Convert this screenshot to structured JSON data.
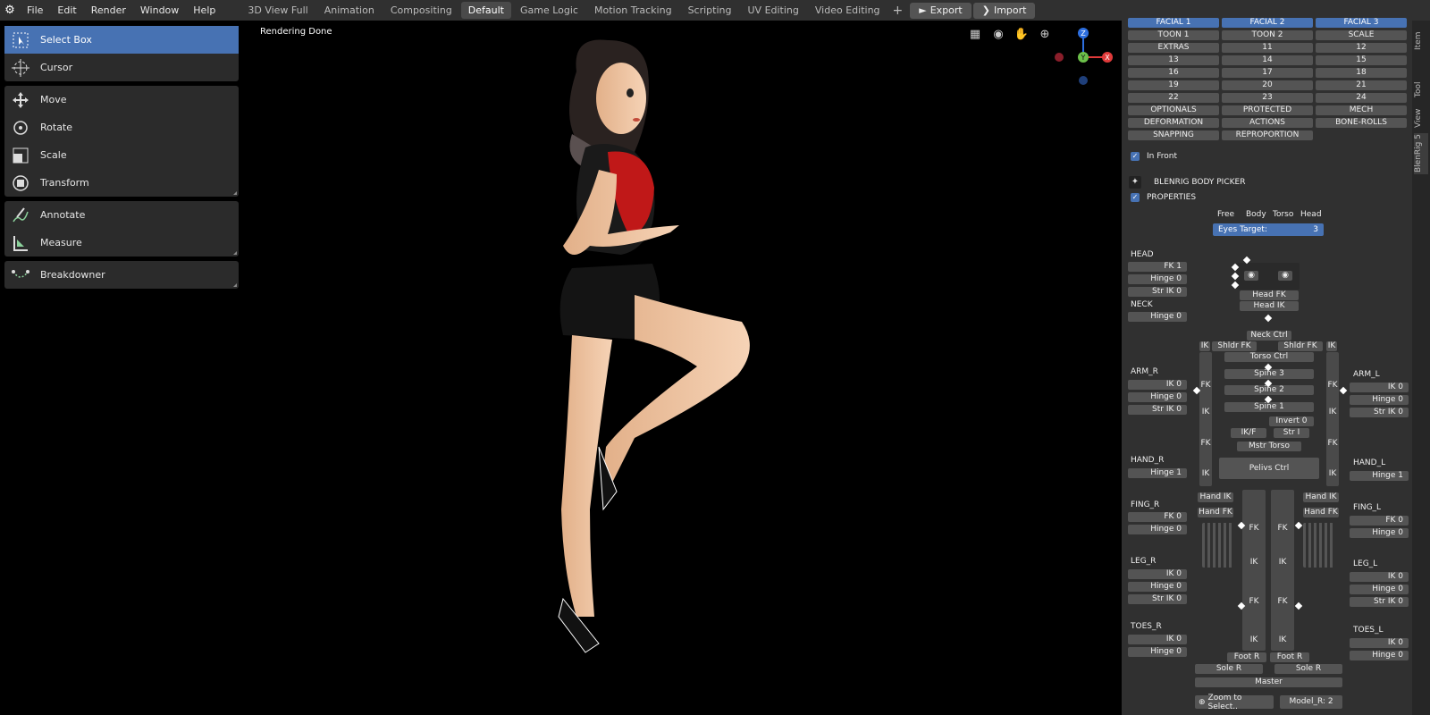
{
  "topbar": {
    "menus": [
      "File",
      "Edit",
      "Render",
      "Window",
      "Help"
    ],
    "workspaces": [
      "3D View Full",
      "Animation",
      "Compositing",
      "Default",
      "Game Logic",
      "Motion Tracking",
      "Scripting",
      "UV Editing",
      "Video Editing"
    ],
    "active_workspace": "Default",
    "plus": "+",
    "export_label": "Export",
    "import_label": "Import"
  },
  "toolbar": {
    "group1": [
      {
        "label": "Select Box",
        "icon": "select-box-icon"
      },
      {
        "label": "Cursor",
        "icon": "cursor-icon"
      }
    ],
    "group2": [
      {
        "label": "Move",
        "icon": "move-icon"
      },
      {
        "label": "Rotate",
        "icon": "rotate-icon"
      },
      {
        "label": "Scale",
        "icon": "scale-icon"
      },
      {
        "label": "Transform",
        "icon": "transform-icon"
      }
    ],
    "group3": [
      {
        "label": "Annotate",
        "icon": "annotate-icon"
      },
      {
        "label": "Measure",
        "icon": "measure-icon"
      }
    ],
    "group4": [
      {
        "label": "Breakdowner",
        "icon": "breakdowner-icon"
      }
    ]
  },
  "viewport": {
    "status": "Rendering Done"
  },
  "gizmo": {
    "z": "Z",
    "y": "Y",
    "x": "X"
  },
  "layers": [
    "FACIAL 1",
    "FACIAL 2",
    "FACIAL 3",
    "TOON 1",
    "TOON 2",
    "SCALE",
    "EXTRAS",
    "11",
    "12",
    "13",
    "14",
    "15",
    "16",
    "17",
    "18",
    "19",
    "20",
    "21",
    "22",
    "23",
    "24",
    "OPTIONALS",
    "PROTECTED",
    "MECH",
    "DEFORMATION",
    "ACTIONS",
    "BONE-ROLLS",
    "SNAPPING",
    "REPROPORTION"
  ],
  "layers_on": [
    "FACIAL 1",
    "FACIAL 2",
    "FACIAL 3"
  ],
  "in_front": "In Front",
  "picker_title": "BLENRIG BODY PICKER",
  "properties": "PROPERTIES",
  "look_modes": [
    "Free",
    "Body",
    "Torso",
    "Head"
  ],
  "eyes_target": {
    "label": "Eyes Target:",
    "value": "3"
  },
  "left_props": {
    "head": {
      "label": "HEAD",
      "items": [
        "FK 1",
        "Hinge 0",
        "Str IK 0"
      ]
    },
    "neck": {
      "label": "NECK",
      "items": [
        "Hinge 0"
      ]
    },
    "arm_r": {
      "label": "ARM_R",
      "items": [
        "IK 0",
        "Hinge 0",
        "Str IK 0"
      ]
    },
    "hand_r": {
      "label": "HAND_R",
      "items": [
        "Hinge 1"
      ]
    },
    "fing_r": {
      "label": "FING_R",
      "items": [
        "FK 0",
        "Hinge 0"
      ]
    },
    "leg_r": {
      "label": "LEG_R",
      "items": [
        "IK 0",
        "Hinge 0",
        "Str IK 0"
      ]
    },
    "toes_r": {
      "label": "TOES_R",
      "items": [
        "IK 0",
        "Hinge 0"
      ]
    }
  },
  "right_props": {
    "arm_l": {
      "label": "ARM_L",
      "items": [
        "IK 0",
        "Hinge 0",
        "Str IK 0"
      ]
    },
    "hand_l": {
      "label": "HAND_L",
      "items": [
        "Hinge 1"
      ]
    },
    "fing_l": {
      "label": "FING_L",
      "items": [
        "FK 0",
        "Hinge 0"
      ]
    },
    "leg_l": {
      "label": "LEG_L",
      "items": [
        "IK 0",
        "Hinge 0",
        "Str IK 0"
      ]
    },
    "toes_l": {
      "label": "TOES_L",
      "items": [
        "IK 0",
        "Hinge 0"
      ]
    }
  },
  "picker": {
    "head_fk": "Head FK",
    "head_ik": "Head IK",
    "neck_ctrl": "Neck Ctrl",
    "shldr_fk_r": "Shldr FK",
    "shldr_fk_l": "Shldr FK",
    "ik": "IK",
    "fk": "FK",
    "torso_ctrl": "Torso Ctrl",
    "spine3": "Spine 3",
    "spine2": "Spine 2",
    "spine1": "Spine 1",
    "invert": "Invert 0",
    "ikf": "IK/F",
    "stri": "Str I",
    "mstr_torso": "Mstr Torso",
    "pelvis": "Pelivs Ctrl",
    "hand_ik_r": "Hand IK",
    "hand_fk_r": "Hand FK",
    "hand_ik_l": "Hand IK",
    "hand_fk_l": "Hand FK",
    "foot_r": "Foot R",
    "foot_r2": "Foot R",
    "sole_r": "Sole R",
    "sole_r2": "Sole R",
    "master": "Master"
  },
  "bottom": {
    "zoom": "Zoom to Select..",
    "model": "Model_R: 2"
  },
  "side_tabs": [
    "Item",
    "Tool",
    "View",
    "BlenRig 5"
  ]
}
